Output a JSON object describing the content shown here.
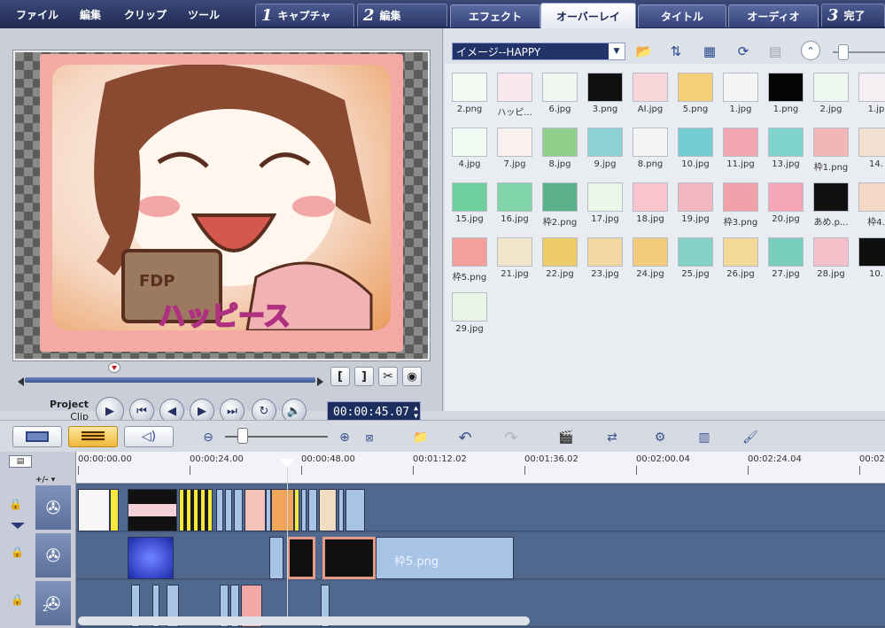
{
  "menu": [
    "ファイル",
    "編集",
    "クリップ",
    "ツール"
  ],
  "steps": [
    {
      "num": "1",
      "label": "キャプチャ"
    },
    {
      "num": "2",
      "label": "編集"
    },
    {
      "num": "3",
      "label": "完了"
    }
  ],
  "subtabs": [
    "エフェクト",
    "オーバーレイ",
    "タイトル",
    "オーディオ"
  ],
  "active_subtab": "オーバーレイ",
  "preview": {
    "mode_project": "Project",
    "mode_clip": "Clip",
    "timecode": "00:00:45.07",
    "trim_in": "[",
    "trim_out": "]"
  },
  "library": {
    "selected": "イメージ--HAPPY",
    "thumbnails": [
      "2.png",
      "ハッピ...",
      "6.jpg",
      "3.png",
      "AI.jpg",
      "5.png",
      "1.jpg",
      "1.png",
      "2.jpg",
      "1.jp",
      "4.jpg",
      "7.jpg",
      "8.jpg",
      "9.jpg",
      "8.png",
      "10.jpg",
      "11.jpg",
      "13.jpg",
      "枠1.png",
      "14.",
      "15.jpg",
      "16.jpg",
      "枠2.png",
      "17.jpg",
      "18.jpg",
      "19.jpg",
      "枠3.png",
      "20.jpg",
      "あめ.p...",
      "枠4.",
      "枠5.png",
      "21.jpg",
      "22.jpg",
      "23.jpg",
      "24.jpg",
      "25.jpg",
      "26.jpg",
      "27.jpg",
      "28.jpg",
      "10.",
      "29.jpg"
    ],
    "thumb_colors": [
      "#f4f9f2",
      "#fbe8ee",
      "#f3f7f1",
      "#101010",
      "#f8d6da",
      "#f6d079",
      "#f5f5f5",
      "#050505",
      "#eef6f0",
      "#f5eef2",
      "#f1f9f3",
      "#faf0ee",
      "#8fd08c",
      "#8ed1d4",
      "#f5f5f5",
      "#75cbd2",
      "#f3a6b1",
      "#7fd4cc",
      "#f2b6b6",
      "#f1dfd0",
      "#6fcf9d",
      "#7fd4a9",
      "#5ab08a",
      "#eaf6ea",
      "#f8c5cf",
      "#f0b7bf",
      "#f2a0a9",
      "#f5a6b7",
      "#111111",
      "#f2d8c5",
      "#f3a09a",
      "#f1e6c9",
      "#eecb6a",
      "#f4d7a2",
      "#f2cc7c",
      "#86d1c6",
      "#f5d999",
      "#79cdbd",
      "#f3bfc9",
      "#0e0e0e",
      "#e8f4e6"
    ]
  },
  "timeline": {
    "ruler": [
      "00:00:00.00",
      "00:00:24.00",
      "00:00:48.00",
      "00:01:12.02",
      "00:01:36.02",
      "00:02:00.04",
      "00:02:24.04",
      "00:02:"
    ],
    "track_menu": "+/- ▾",
    "overlay_clip_label": "枠5.png",
    "track_number": "2"
  }
}
